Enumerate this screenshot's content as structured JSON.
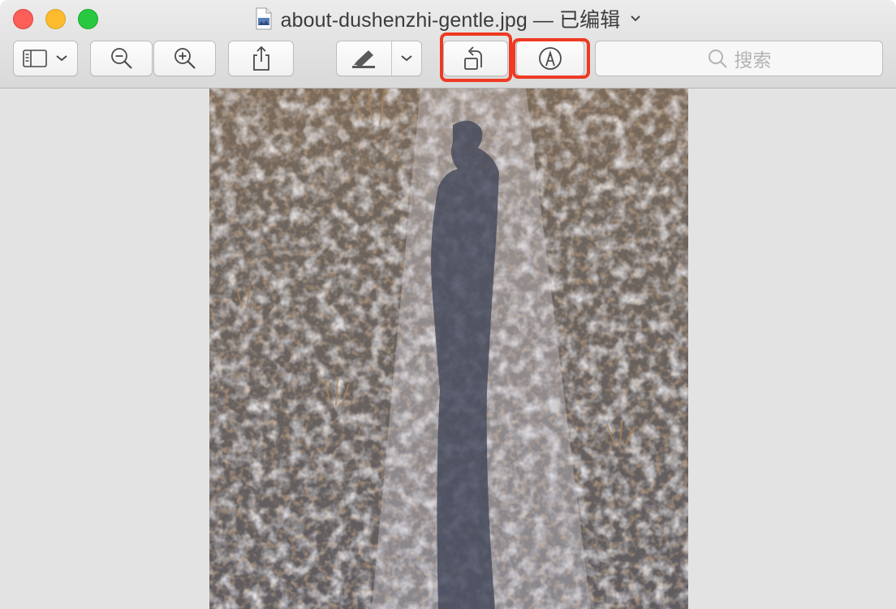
{
  "window": {
    "title": "about-dushenzhi-gentle.jpg — 已编辑"
  },
  "toolbar": {
    "sidebar_button": "sidebar-toggle",
    "zoom_out_button": "zoom-out",
    "zoom_in_button": "zoom-in",
    "share_button": "share",
    "markup_menu": "highlighter",
    "rotate_button": "rotate-left",
    "annotate_button": "markup-pen",
    "search": {
      "placeholder": "搜索"
    }
  },
  "highlights": [
    "rotate-button",
    "markup-button"
  ],
  "colors": {
    "highlight": "#ee3a24",
    "close": "#fc5f57",
    "minimize": "#fdbc2e",
    "maximize": "#28c840"
  },
  "image": {
    "description_icon": "photo-snowy-path-shadow"
  }
}
